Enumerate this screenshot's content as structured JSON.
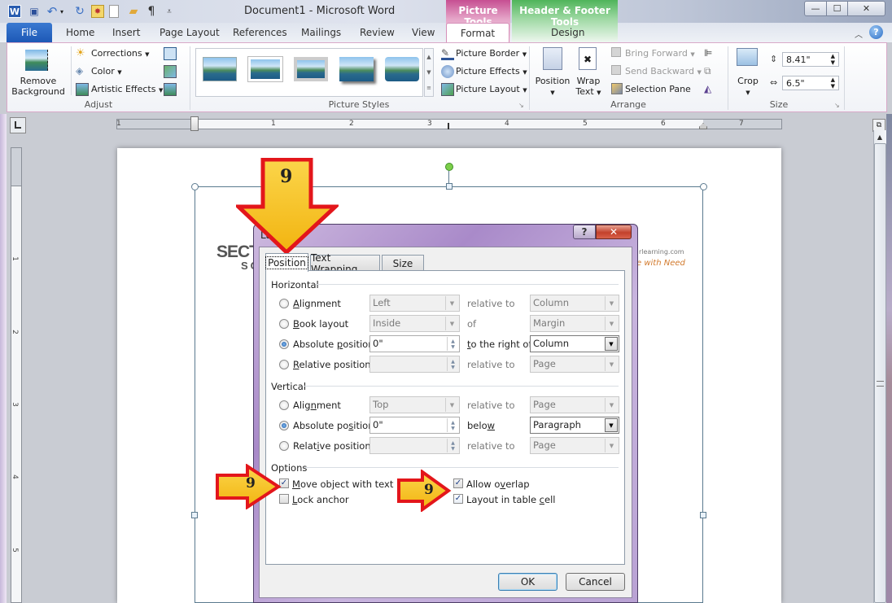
{
  "window": {
    "title": "Document1  -  Microsoft Word",
    "controls": {
      "minimize": "—",
      "maximize": "☐",
      "close": "✕"
    }
  },
  "quick_access": [
    {
      "name": "word-logo-icon",
      "glyph": "W"
    },
    {
      "name": "save-icon",
      "glyph": "💾"
    },
    {
      "name": "undo-icon",
      "glyph": "↶"
    },
    {
      "name": "undo-dropdown-icon",
      "glyph": "▾"
    },
    {
      "name": "redo-icon",
      "glyph": "↻"
    },
    {
      "name": "insert-picture-icon",
      "glyph": "✸"
    },
    {
      "name": "new-document-icon",
      "glyph": "🗋"
    },
    {
      "name": "open-folder-icon",
      "glyph": "📂"
    },
    {
      "name": "paragraph-mark-icon",
      "glyph": "¶"
    },
    {
      "name": "customize-qat-icon",
      "glyph": "⩡"
    }
  ],
  "contextual_tabs": {
    "picture_tools": {
      "label": "Picture Tools",
      "tab": "Format",
      "color": "#c64f92"
    },
    "header_footer_tools": {
      "label": "Header & Footer Tools",
      "tab": "Design",
      "color": "#4fb45a"
    }
  },
  "ribbon_tabs": [
    "File",
    "Home",
    "Insert",
    "Page Layout",
    "References",
    "Mailings",
    "Review",
    "View"
  ],
  "ribbon": {
    "adjust": {
      "label": "Adjust",
      "remove_background": [
        "Remove",
        "Background"
      ],
      "corrections": "Corrections",
      "color": "Color",
      "artistic_effects": "Artistic Effects"
    },
    "picture_styles": {
      "label": "Picture Styles",
      "picture_border": "Picture Border",
      "picture_effects": "Picture Effects",
      "picture_layout": "Picture Layout"
    },
    "arrange": {
      "label": "Arrange",
      "position": "Position",
      "wrap_text": [
        "Wrap",
        "Text"
      ],
      "bring_forward": "Bring Forward",
      "send_backward": "Send Backward",
      "selection_pane": "Selection Pane"
    },
    "size": {
      "label": "Size",
      "crop": "Crop",
      "height": "8.41\"",
      "width": "6.5\""
    }
  },
  "ruler": {
    "horizontal": [
      "1",
      "1",
      "2",
      "3",
      "4",
      "5",
      "6",
      "7"
    ],
    "vertical": [
      "1",
      "2",
      "3",
      "4",
      "5"
    ]
  },
  "document": {
    "logo_line1": "SECTO",
    "logo_line2": "SO",
    "url_fragment": "rlearning.com",
    "tagline_fragment": "e with Need"
  },
  "dialog": {
    "title": "Layout",
    "help": "?",
    "close": "✕",
    "tabs": [
      "Position",
      "Text Wrapping",
      "Size"
    ],
    "active_tab": "Position",
    "horizontal": {
      "label": "Horizontal",
      "rows": [
        {
          "option": "Alignment",
          "selected": false,
          "value": "Left",
          "relation": "relative to",
          "target": "Column",
          "enabled": false
        },
        {
          "option": "Book layout",
          "selected": false,
          "value": "Inside",
          "relation": "of",
          "target": "Margin",
          "enabled": false
        },
        {
          "option": "Absolute position",
          "selected": true,
          "value": "0\"",
          "relation": "to the right of",
          "target": "Column",
          "enabled": true
        },
        {
          "option": "Relative position",
          "selected": false,
          "value": "",
          "relation": "relative to",
          "target": "Page",
          "enabled": false
        }
      ]
    },
    "vertical": {
      "label": "Vertical",
      "rows": [
        {
          "option": "Alignment",
          "selected": false,
          "value": "Top",
          "relation": "relative to",
          "target": "Page",
          "enabled": false
        },
        {
          "option": "Absolute position",
          "selected": true,
          "value": "0\"",
          "relation": "below",
          "target": "Paragraph",
          "enabled": true
        },
        {
          "option": "Relative position",
          "selected": false,
          "value": "",
          "relation": "relative to",
          "target": "Page",
          "enabled": false
        }
      ]
    },
    "options": {
      "label": "Options",
      "move_object_with_text": {
        "label": "Move object with text",
        "checked": true
      },
      "lock_anchor": {
        "label": "Lock anchor",
        "checked": false
      },
      "allow_overlap": {
        "label": "Allow overlap",
        "checked": true
      },
      "layout_in_table_cell": {
        "label": "Layout in table cell",
        "checked": true
      }
    },
    "ok": "OK",
    "cancel": "Cancel"
  },
  "annotations": {
    "step_number": "9",
    "arrow_fill": "#f7c21a",
    "arrow_stroke": "#e3161b"
  }
}
